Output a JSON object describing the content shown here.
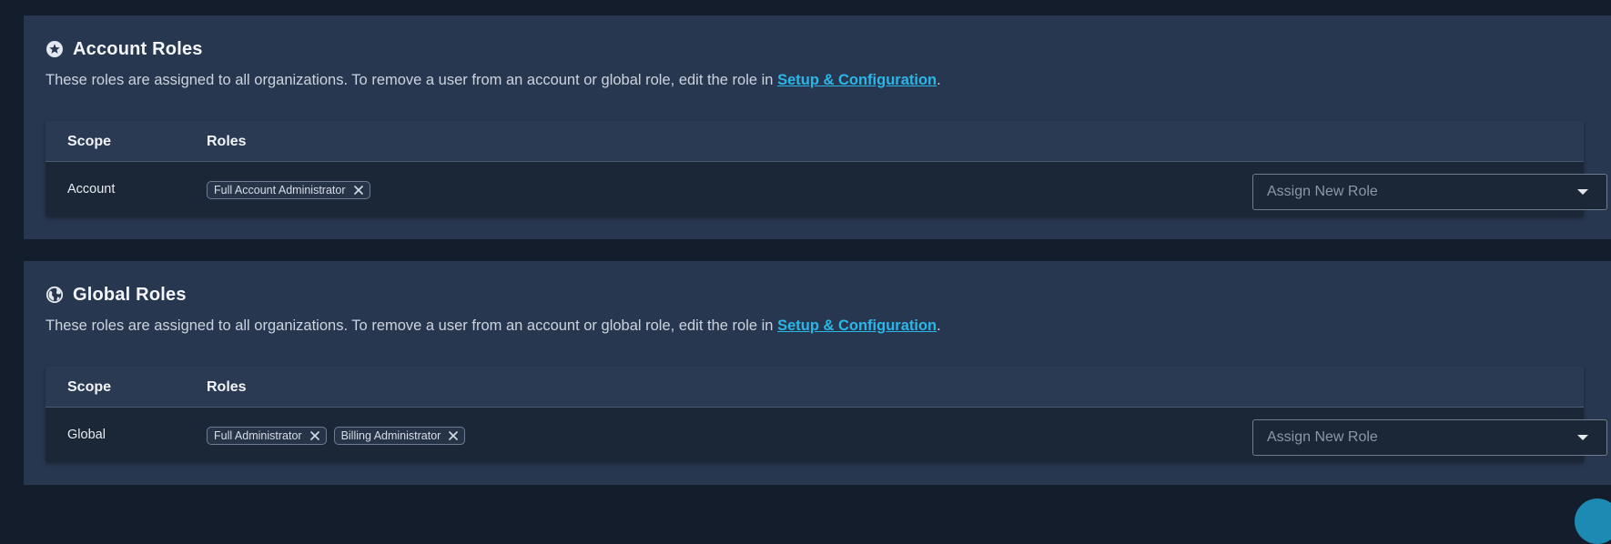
{
  "colors": {
    "page_background": "#131d2b",
    "panel_background": "#283750",
    "link": "#2bb6e8",
    "table_header": "#2a3a52",
    "table_row": "#1b2637"
  },
  "account_roles": {
    "icon": "star-circle-icon",
    "title": "Account Roles",
    "description_prefix": "These roles are assigned to all organizations. To remove a user from an account or global role, edit the role in ",
    "link_text": "Setup & Configuration",
    "description_suffix": ".",
    "headers": {
      "scope": "Scope",
      "roles": "Roles"
    },
    "row": {
      "scope": "Account",
      "roles": [
        {
          "label": "Full Account Administrator",
          "remove_icon": "close-icon"
        }
      ],
      "assign_placeholder": "Assign New Role"
    }
  },
  "global_roles": {
    "icon": "globe-icon",
    "title": "Global Roles",
    "description_prefix": "These roles are assigned to all organizations. To remove a user from an account or global role, edit the role in ",
    "link_text": "Setup & Configuration",
    "description_suffix": ".",
    "headers": {
      "scope": "Scope",
      "roles": "Roles"
    },
    "row": {
      "scope": "Global",
      "roles": [
        {
          "label": "Full Administrator",
          "remove_icon": "close-icon"
        },
        {
          "label": "Billing Administrator",
          "remove_icon": "close-icon"
        }
      ],
      "assign_placeholder": "Assign New Role"
    }
  }
}
